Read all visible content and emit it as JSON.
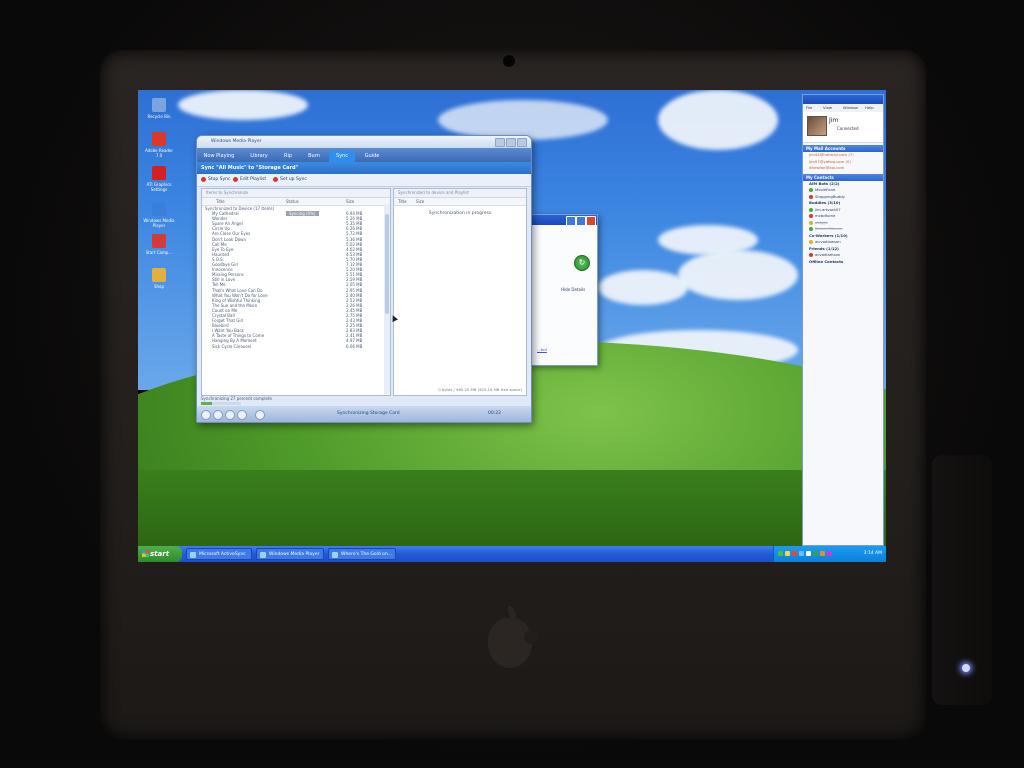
{
  "desktop_icons": [
    {
      "label": "Recycle Bin",
      "color": "#7aa5e0"
    },
    {
      "label": "Adobe Reader 7.0",
      "color": "#d83a2a"
    },
    {
      "label": "ATI Graphics Settings",
      "color": "#d32020"
    },
    {
      "label": "Windows Media Player",
      "color": "#3a7fd8"
    },
    {
      "label": "Start Camp...",
      "color": "#d33a3a"
    },
    {
      "label": "Shop",
      "color": "#e0b040"
    }
  ],
  "wmp": {
    "title": "Windows Media Player",
    "tabs": [
      "Now Playing",
      "Library",
      "Rip",
      "Burn",
      "Sync",
      "Guide"
    ],
    "active_tab": "Sync",
    "heading": "Sync \"All Music\" to \"Storage Card\"",
    "actions": [
      "Stop Sync",
      "Edit Playlist",
      "Set up Sync"
    ],
    "left_pane_header": "Items to Synchronize",
    "right_pane_header": "Synchronized to device and Playlist",
    "columns": {
      "title": "Title",
      "status": "Status",
      "size": "Size"
    },
    "right_columns": {
      "title": "Title",
      "size": "Size"
    },
    "group_row": "Synchronized to Device (17 Items)",
    "tracks": [
      {
        "title": "My Cathedral",
        "status": "Syncing (0%)",
        "size": "6.94 MB"
      },
      {
        "title": "Wonder",
        "status": "",
        "size": "5.26 MB"
      },
      {
        "title": "Spare An Angel",
        "status": "",
        "size": "5.35 MB"
      },
      {
        "title": "Circle Up",
        "status": "",
        "size": "6.26 MB"
      },
      {
        "title": "Are Close Our Eyes",
        "status": "",
        "size": "5.72 MB"
      },
      {
        "title": "Don't Look Down",
        "status": "",
        "size": "5.36 MB"
      },
      {
        "title": "Call Me",
        "status": "",
        "size": "5.02 MB"
      },
      {
        "title": "Eye To Eye",
        "status": "",
        "size": "4.02 MB"
      },
      {
        "title": "Haunted",
        "status": "",
        "size": "4.53 MB"
      },
      {
        "title": "S.O.S.",
        "status": "",
        "size": "5.70 MB"
      },
      {
        "title": "Goodbye Girl",
        "status": "",
        "size": "7.12 MB"
      },
      {
        "title": "Innocence",
        "status": "",
        "size": "5.20 MB"
      },
      {
        "title": "Missing Persons",
        "status": "",
        "size": "5.51 MB"
      },
      {
        "title": "Still in Love",
        "status": "",
        "size": "2.59 MB"
      },
      {
        "title": "Tell Me",
        "status": "",
        "size": "2.05 MB"
      },
      {
        "title": "That's What Love Can Do",
        "status": "",
        "size": "2.95 MB"
      },
      {
        "title": "What You Won't Do for Love",
        "status": "",
        "size": "2.40 MB"
      },
      {
        "title": "King of Wishful Thinking",
        "status": "",
        "size": "2.52 MB"
      },
      {
        "title": "The Sun and the Moon",
        "status": "",
        "size": "2.26 MB"
      },
      {
        "title": "Count on Me",
        "status": "",
        "size": "2.45 MB"
      },
      {
        "title": "Crystal Ball",
        "status": "",
        "size": "2.75 MB"
      },
      {
        "title": "Forget That Girl",
        "status": "",
        "size": "2.43 MB"
      },
      {
        "title": "Bluebird",
        "status": "",
        "size": "2.25 MB"
      },
      {
        "title": "I Want You Back",
        "status": "",
        "size": "2.83 MB"
      },
      {
        "title": "A Taste of Things to Come",
        "status": "",
        "size": "2.41 MB"
      },
      {
        "title": "Hanging By A Moment",
        "status": "",
        "size": "4.97 MB"
      },
      {
        "title": "Sick Cycle Carousel",
        "status": "",
        "size": "6.06 MB"
      }
    ],
    "right_message": "Synchronization in progress",
    "right_footer": "0 bytes / 960.25 MB (925.16 MB free space)",
    "sync_status": "Synchronizing 27 percent complete",
    "sync_progress": 0.27,
    "now_playing": "Synchronizing Storage Card",
    "time": "00:22"
  },
  "activesync": {
    "details_label": "Hide Details",
    "sync_icon": "sync-icon",
    "link_text": "...ted"
  },
  "messenger": {
    "menu": [
      "File",
      "View",
      "Window",
      "Help"
    ],
    "user_name": "Jim",
    "user_status": "Connected",
    "mail_header": "My Mail Accounts",
    "mail_accounts": [
      "jim44@hotmail.com (7)",
      "jim97@yahoo.com (0)",
      "ithewfan@aol.com"
    ],
    "contacts_header": "My Contacts",
    "contacts": [
      {
        "text": "AIM Bots (2/2)",
        "kind": "group"
      },
      {
        "text": "MovieFone",
        "kind": "contact"
      },
      {
        "text": "ShoppingBuddy",
        "kind": "contact"
      },
      {
        "text": "Buddies (3/10)",
        "kind": "group"
      },
      {
        "text": "jim.artvant07",
        "kind": "contact"
      },
      {
        "text": "mcbdfume",
        "kind": "contact"
      },
      {
        "text": "oldggs",
        "kind": "struck"
      },
      {
        "text": "KeenerSKeene",
        "kind": "struck"
      },
      {
        "text": "Co-Workers (1/10)",
        "kind": "group"
      },
      {
        "text": "aicvadlawson",
        "kind": "contact"
      },
      {
        "text": "Friends (1/12)",
        "kind": "group"
      },
      {
        "text": "acvadlamson",
        "kind": "contact"
      },
      {
        "text": "Offline Contacts",
        "kind": "group"
      }
    ]
  },
  "taskbar": {
    "start_label": "start",
    "tasks": [
      "Microsoft ActiveSync",
      "Windows Media Player",
      "Where's The Gold on..."
    ],
    "clock": "3:14 AM"
  }
}
